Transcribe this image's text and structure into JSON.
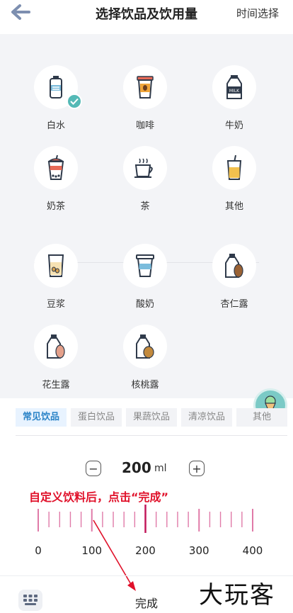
{
  "header": {
    "title": "选择饮品及饮用量",
    "time_select_label": "时间选择"
  },
  "drinks_common": [
    {
      "label": "白水",
      "icon": "water-bottle-icon",
      "selected": true
    },
    {
      "label": "咖啡",
      "icon": "coffee-cup-icon",
      "selected": false
    },
    {
      "label": "牛奶",
      "icon": "milk-bottle-icon",
      "selected": false
    },
    {
      "label": "奶茶",
      "icon": "milk-tea-icon",
      "selected": false
    },
    {
      "label": "茶",
      "icon": "tea-cup-icon",
      "selected": false
    },
    {
      "label": "其他",
      "icon": "other-drink-icon",
      "selected": false
    }
  ],
  "drinks_extra": [
    {
      "label": "豆浆",
      "icon": "soy-milk-icon"
    },
    {
      "label": "酸奶",
      "icon": "yogurt-icon"
    },
    {
      "label": "杏仁露",
      "icon": "almond-drink-icon"
    },
    {
      "label": "花生露",
      "icon": "peanut-drink-icon"
    },
    {
      "label": "核桃露",
      "icon": "walnut-drink-icon"
    }
  ],
  "tabs": [
    {
      "label": "常见饮品",
      "active": true
    },
    {
      "label": "蛋白饮品",
      "active": false
    },
    {
      "label": "果蔬饮品",
      "active": false
    },
    {
      "label": "清凉饮品",
      "active": false
    },
    {
      "label": "其他",
      "active": false
    }
  ],
  "amount": {
    "value": "200",
    "unit": "ml",
    "minus": "−",
    "plus": "+"
  },
  "ruler": {
    "min": 0,
    "max": 400,
    "labels": [
      "0",
      "100",
      "200",
      "300",
      "400"
    ],
    "selected": 200
  },
  "annotation": "自定义饮料后，点击“完成”",
  "footer": {
    "done_label": "完成"
  },
  "watermark": "大玩客",
  "colors": {
    "accent": "#54b9b6",
    "annotation": "#e0112a",
    "tick": "#e07aa8",
    "tab_active": "#2a83c7"
  }
}
